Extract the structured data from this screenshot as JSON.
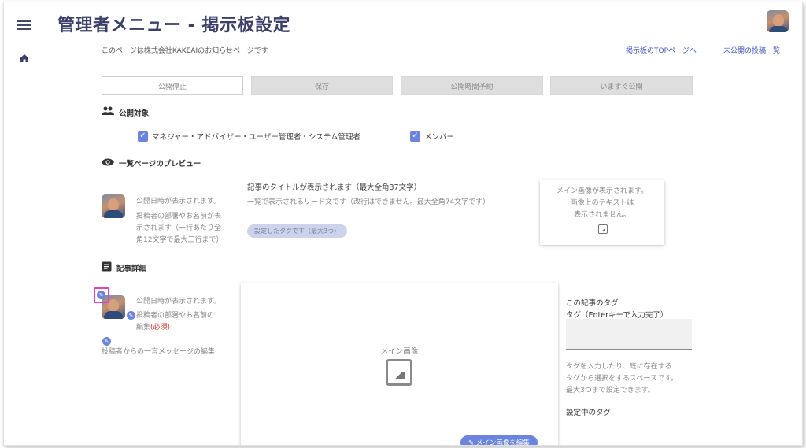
{
  "header": {
    "title": "管理者メニュー - 掲示板設定",
    "notice": "このページは株式会社KAKEAIのお知らせページです",
    "link_top": "掲示板のTOPページへ",
    "link_unpublished": "未公開の投稿一覧"
  },
  "toolbar": {
    "stop": "公開停止",
    "save": "保存",
    "schedule": "公開時間予約",
    "publish_now": "いますぐ公開"
  },
  "audience": {
    "title": "公開対象",
    "option1": "マネジャー・アドバイザー・ユーザー管理者・システム管理者",
    "option2": "メンバー"
  },
  "preview": {
    "title": "一覧ページのプレビュー",
    "date": "公開日時が表示されます。",
    "author_line1": "投稿者の部署やお名前が表",
    "author_line2": "示されます（一行あたり全",
    "author_line3": "角12文字で最大三行まで）",
    "article_title": "記事のタイトルが表示されます（最大全角37文字）",
    "lead": "一覧で表示されるリード文です（改行はできません。最大全角74文字です）",
    "tag": "設定したタグです（最大3つ）",
    "image_line1": "メイン画像が表示されます。",
    "image_line2": "画像上のテキストは",
    "image_line3": "表示されません。"
  },
  "detail": {
    "title": "記事詳細",
    "date": "公開日時が表示されます。",
    "author_edit_line1": "投稿者の部署やお名前の",
    "author_edit_line2": "編集",
    "required": "(必須)",
    "message_edit": "投稿者からの一言メッセージの編集",
    "main_image": "メイン画像",
    "edit_image_button": "メイン画像を編集",
    "tag_heading": "この記事のタグ",
    "tag_input_label": "タグ（Enterキーで入力完了）",
    "tag_help_line1": "タグを入力したり、既に存在する",
    "tag_help_line2": "タグから選択をするスペースです。",
    "tag_help_line3": "最大3つまで設定できます。",
    "current_tags": "設定中のタグ"
  },
  "colors": {
    "accent": "#6b84e0",
    "title": "#3b3f6b",
    "link": "#3f56c6",
    "highlight": "#e83fc8",
    "required": "#e0302a"
  }
}
